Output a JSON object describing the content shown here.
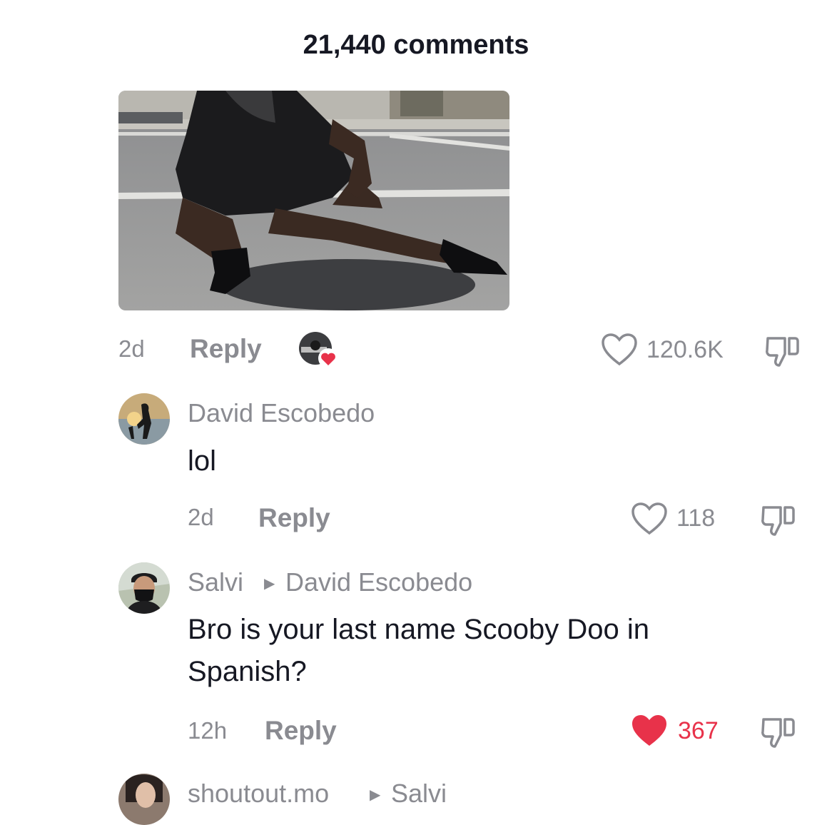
{
  "header": {
    "comments_count": "21,440 comments"
  },
  "comment0": {
    "time": "2d",
    "reply": "Reply",
    "likes": "120.6K"
  },
  "comment1": {
    "user": "David Escobedo",
    "text": "lol",
    "time": "2d",
    "reply": "Reply",
    "likes": "118"
  },
  "comment2": {
    "user": "Salvi",
    "reply_to": "David Escobedo",
    "text_line1": "Bro is your last name Scooby Doo in",
    "text_line2": "Spanish?",
    "time": "12h",
    "reply": "Reply",
    "likes": "367"
  },
  "comment3": {
    "user": "shoutout.mo",
    "reply_to": "Salvi"
  },
  "colors": {
    "like_active": "#e8324a",
    "secondary_text": "#8a8b91",
    "primary_text": "#161823"
  },
  "icons": [
    "heart-outline-icon",
    "heart-filled-icon",
    "dislike-icon",
    "reply-arrow-icon"
  ]
}
